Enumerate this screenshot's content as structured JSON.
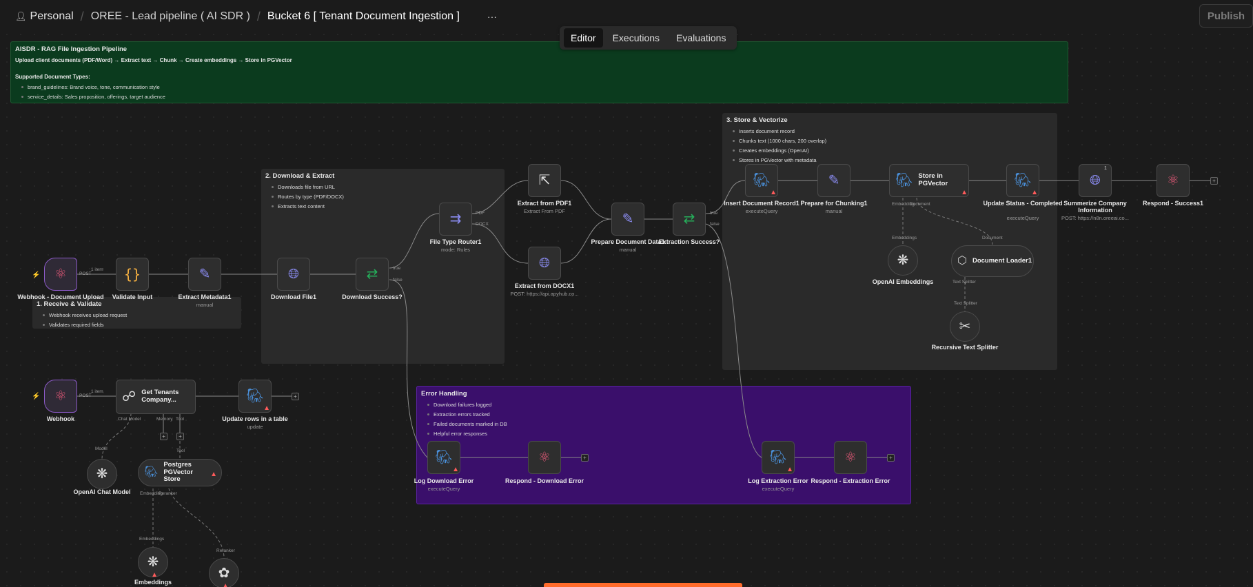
{
  "breadcrumb": {
    "owner": "Personal",
    "project": "OREE - Lead pipeline ( AI SDR )",
    "workflow": "Bucket 6 [ Tenant Document Ingestion ]",
    "more": "···"
  },
  "publish_label": "Publish",
  "tabs": [
    "Editor",
    "Executions",
    "Evaluations"
  ],
  "sticky_top": {
    "title": "AISDR - RAG File Ingestion Pipeline",
    "line": "Upload client documents (PDF/Word) → Extract text → Chunk → Create embeddings → Store in PGVector",
    "types_header": "Supported Document Types:",
    "items": [
      "brand_guidelines: Brand voice, tone, communication style",
      "service_details: Sales proposition, offerings, target audience"
    ]
  },
  "sticky_receive": {
    "title": "1. Receive & Validate",
    "items": [
      "Webhook receives upload request",
      "Validates required fields"
    ]
  },
  "sticky_download": {
    "title": "2. Download & Extract",
    "items": [
      "Downloads file from URL",
      "Routes by type (PDF/DOCX)",
      "Extracts text content"
    ]
  },
  "sticky_store": {
    "title": "3. Store & Vectorize",
    "items": [
      "Inserts document record",
      "Chunks text (1000 chars, 200 overlap)",
      "Creates embeddings (OpenAI)",
      "Stores in PGVector with metadata"
    ]
  },
  "sticky_error": {
    "title": "Error Handling",
    "items": [
      "Download failures logged",
      "Extraction errors tracked",
      "Failed documents marked in DB",
      "Helpful error responses"
    ]
  },
  "nodes": {
    "webhook_doc": {
      "label": "Webhook - Document Upload",
      "tag": "POST",
      "count": "1 item"
    },
    "validate": {
      "label": "Validate Input"
    },
    "extract_meta": {
      "label": "Extract Metadata1",
      "sub": "manual"
    },
    "download": {
      "label": "Download File1"
    },
    "download_ok": {
      "label": "Download Success?",
      "true": "true",
      "false": "false"
    },
    "router": {
      "label": "File Type Router1",
      "sub": "mode: Rules",
      "out1": "PDF",
      "out2": "DOCX"
    },
    "extract_pdf": {
      "label": "Extract from PDF1",
      "sub": "Extract From PDF"
    },
    "extract_docx": {
      "label": "Extract from DOCX1",
      "sub": "POST: https://api.apyhub.co..."
    },
    "prep_doc": {
      "label": "Prepare Document Data1",
      "sub": "manual"
    },
    "extract_ok": {
      "label": "Extraction Success?",
      "true": "true",
      "false": "false"
    },
    "insert_doc": {
      "label": "Insert Document Record1",
      "sub": "executeQuery"
    },
    "prep_chunk": {
      "label": "Prepare for Chunking1",
      "sub": "manual"
    },
    "store_pg": {
      "label": "Store in PGVector",
      "port1": "Embedding",
      "port2": "Document"
    },
    "update_status": {
      "label": "Update Status - Completed",
      "sub": "executeQuery"
    },
    "summarize": {
      "label": "Summerize Company Information",
      "sub": "POST: https://n8n.oreeai.co...",
      "badge": "1"
    },
    "respond_success": {
      "label": "Respond - Success1"
    },
    "openai_emb": {
      "label": "OpenAI Embeddings",
      "port_label": "Embeddings"
    },
    "doc_loader": {
      "label": "Document Loader1",
      "port_label": "Document",
      "out_label": "Text Splitter"
    },
    "recursive": {
      "label": "Recursive Text Splitter",
      "port_label": "Text Splitter"
    },
    "webhook": {
      "label": "Webhook",
      "tag": "POST",
      "count": "1 item"
    },
    "get_tenants": {
      "label": "Get Tenants Company...",
      "p1": "Chat Model",
      "p2": "Memory",
      "p3": "Tool"
    },
    "update_rows": {
      "label": "Update rows in a table",
      "sub": "update"
    },
    "openai_chat": {
      "label": "OpenAI Chat Model",
      "port_label": "Model"
    },
    "pg_store": {
      "label": "Postgres PGVector Store",
      "port_label": "Tool",
      "p1": "Embedding",
      "p2": "Reranker"
    },
    "embeddings": {
      "label": "Embeddings",
      "port_label": "Embeddings"
    },
    "reranker": {
      "port_label": "Reranker"
    },
    "log_download": {
      "label": "Log Download Error",
      "sub": "executeQuery"
    },
    "respond_download": {
      "label": "Respond - Download Error"
    },
    "log_extract": {
      "label": "Log Extraction Error",
      "sub": "executeQuery"
    },
    "respond_extract": {
      "label": "Respond - Extraction Error"
    }
  },
  "icons": {
    "webhook": "webhook-icon",
    "code": "curly-braces-icon",
    "edit": "pencil-icon",
    "http": "globe-icon",
    "if": "branch-icon",
    "postgres": "elephant-icon",
    "openai": "openai-icon",
    "scissors": "scissors-icon",
    "loader": "hexagon-icon",
    "agent": "robot-icon",
    "cohere": "cohere-icon"
  },
  "colors": {
    "sticky_top": "#0b3b1e",
    "sticky_gray": "#2a2a2a",
    "sticky_error": "#3a0f6b",
    "webhook": "#e85a7a",
    "code": "#f5b041",
    "edit": "#8b8cf2",
    "http": "#8b8cf2",
    "if": "#25b05b",
    "warn": "#ff5b5b",
    "accent": "#ff6b2b"
  }
}
